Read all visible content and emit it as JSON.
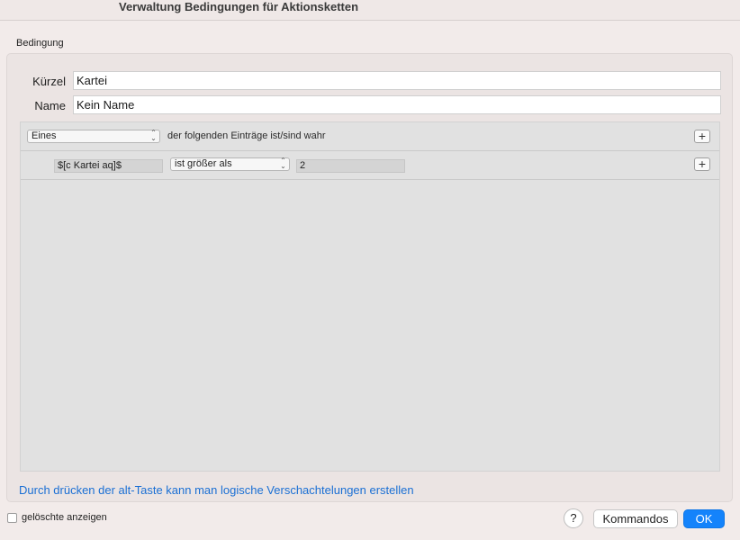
{
  "window": {
    "title": "Verwaltung Bedingungen für Aktionsketten"
  },
  "group": {
    "label": "Bedingung"
  },
  "fields": {
    "kuerzel_label": "Kürzel",
    "kuerzel_value": "Kartei",
    "name_label": "Name",
    "name_value": "Kein Name"
  },
  "rules": {
    "header": {
      "match_select": "Eines",
      "match_text": "der folgenden Einträge ist/sind wahr",
      "add_symbol": "+"
    },
    "items": [
      {
        "variable": "$[c Kartei aq]$",
        "operator": "ist größer als",
        "value": "2",
        "add_symbol": "+"
      }
    ]
  },
  "hint": "Durch drücken der alt-Taste kann man logische Verschachtelungen erstellen",
  "footer": {
    "show_deleted_label": "gelöschte anzeigen",
    "show_deleted_checked": false,
    "help_symbol": "?",
    "commands_label": "Kommandos",
    "ok_label": "OK"
  },
  "colors": {
    "accent": "#1483fb",
    "hint_link": "#1a6fd4",
    "window_bg": "#f2ebea",
    "rule_area_bg": "#e1e1e1"
  },
  "icons": {
    "help": "question-icon",
    "add": "plus-icon",
    "popup": "chevron-updown-icon"
  }
}
